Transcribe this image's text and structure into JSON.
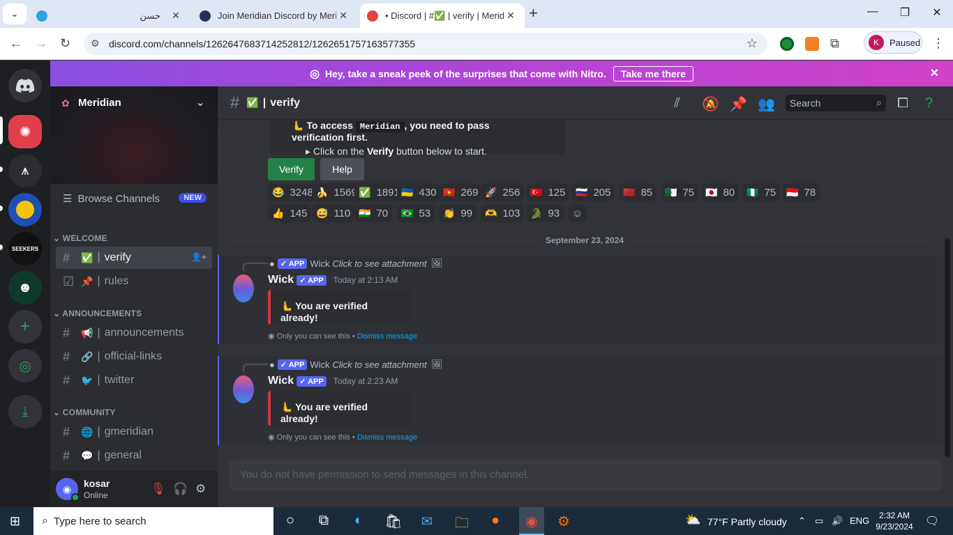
{
  "browser": {
    "tabs": [
      {
        "title": "حسن",
        "close": "✕"
      },
      {
        "title": "Join Meridian Discord by Merid",
        "close": "✕"
      },
      {
        "title": "• Discord | #✅ | verify | Merid",
        "close": "✕"
      }
    ],
    "new_tab": "+",
    "url": "discord.com/channels/1262647683714252812/1262651757163577355",
    "profile_initial": "K",
    "profile_status": "Paused"
  },
  "nitro_banner": {
    "text": "Hey, take a sneak peek of the surprises that come with Nitro.",
    "button": "Take me there"
  },
  "server": {
    "name": "Meridian"
  },
  "sidebar": {
    "browse": "Browse Channels",
    "browse_badge": "NEW",
    "categories": [
      {
        "name": "WELCOME",
        "channels": [
          {
            "emoji": "✅",
            "name": "verify"
          },
          {
            "emoji": "📌",
            "name": "rules"
          }
        ]
      },
      {
        "name": "ANNOUNCEMENTS",
        "channels": [
          {
            "emoji": "📢",
            "name": "announcements"
          },
          {
            "emoji": "🔗",
            "name": "official-links"
          },
          {
            "emoji": "🐦",
            "name": "twitter"
          }
        ]
      },
      {
        "name": "COMMUNITY",
        "channels": [
          {
            "emoji": "🌐",
            "name": "gmeridian"
          },
          {
            "emoji": "💬",
            "name": "general"
          }
        ]
      }
    ]
  },
  "user": {
    "name": "kosar",
    "status": "Online"
  },
  "channel": {
    "emoji": "✅",
    "name": "verify",
    "search_placeholder": "Search"
  },
  "embed": {
    "line1_pre": "To access",
    "line1_code": "Meridian",
    "line1_post": ", you need to pass verification first.",
    "line2_pre": "Click on the",
    "line2_bold": "Verify",
    "line2_post": "button below to start."
  },
  "buttons": {
    "verify": "Verify",
    "help": "Help"
  },
  "reactions": [
    {
      "emoji": "😂",
      "count": "3248"
    },
    {
      "emoji": "🍌",
      "count": "1569"
    },
    {
      "emoji": "✅",
      "count": "1891"
    },
    {
      "emoji": "🇺🇦",
      "count": "430"
    },
    {
      "emoji": "🇻🇳",
      "count": "269"
    },
    {
      "emoji": "🚀",
      "count": "256"
    },
    {
      "emoji": "🇹🇷",
      "count": "125"
    },
    {
      "emoji": "🇷🇺",
      "count": "205"
    },
    {
      "emoji": "🇲🇦",
      "count": "85"
    },
    {
      "emoji": "🇩🇿",
      "count": "75"
    },
    {
      "emoji": "🇯🇵",
      "count": "80"
    },
    {
      "emoji": "🇳🇬",
      "count": "75"
    },
    {
      "emoji": "🇮🇩",
      "count": "78"
    },
    {
      "emoji": "👍",
      "count": "145"
    },
    {
      "emoji": "😅",
      "count": "110"
    },
    {
      "emoji": "🇮🇳",
      "count": "70"
    },
    {
      "emoji": "🇧🇷",
      "count": "53"
    },
    {
      "emoji": "👏",
      "count": "99"
    },
    {
      "emoji": "🫶",
      "count": "103"
    },
    {
      "emoji": "🐊",
      "count": "93"
    }
  ],
  "date_divider": "September 23, 2024",
  "messages": [
    {
      "reply_author": "Wick",
      "reply_text": "Click to see attachment",
      "author": "Wick",
      "app_tag": "✓ APP",
      "time": "Today at 2:13 AM",
      "card": "You are verified already!",
      "eph": "Only you can see this •",
      "dismiss": "Dismiss message"
    },
    {
      "reply_author": "Wick",
      "reply_text": "Click to see attachment",
      "author": "Wick",
      "app_tag": "✓ APP",
      "time": "Today at 2:23 AM",
      "card": "You are verified already!",
      "eph": "Only you can see this •",
      "dismiss": "Dismiss message"
    }
  ],
  "composer": "You do not have permission to send messages in this channel.",
  "taskbar": {
    "search": "Type here to search",
    "weather": "77°F  Partly cloudy",
    "lang": "ENG",
    "time": "2:32 AM",
    "date": "9/23/2024"
  }
}
